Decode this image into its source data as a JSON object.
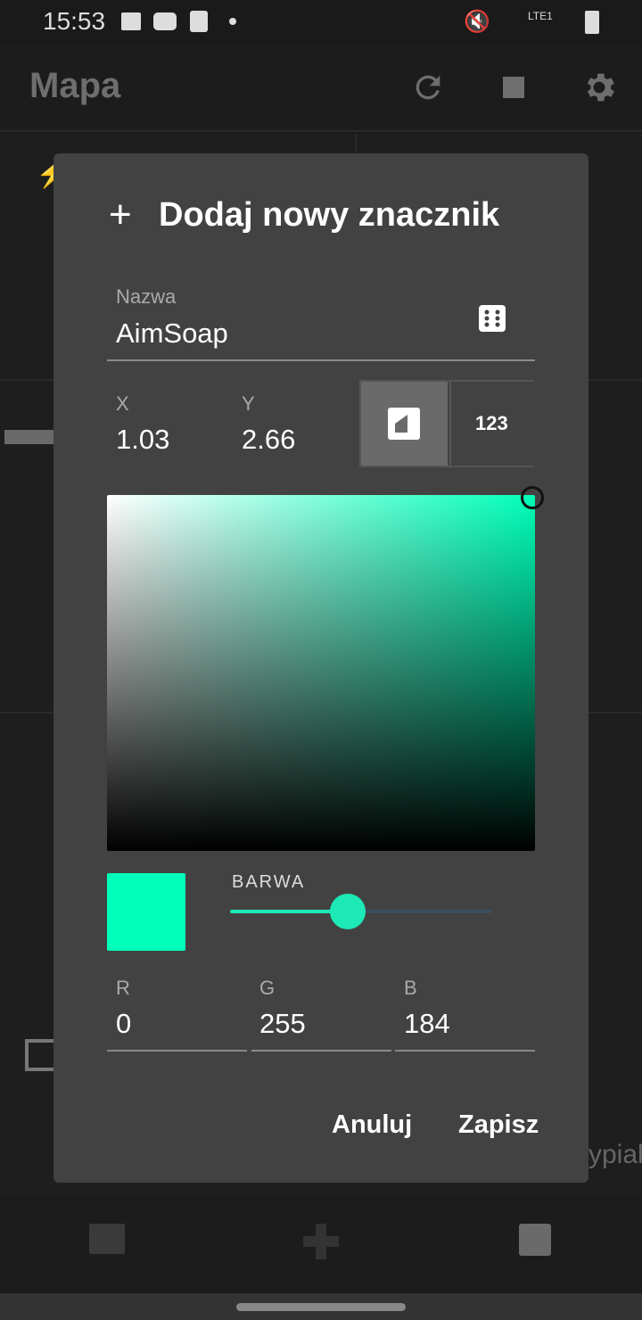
{
  "status_bar": {
    "time": "15:53",
    "network": "LTE1"
  },
  "app_bar": {
    "title": "Mapa"
  },
  "map": {
    "partial_label": "ypialn"
  },
  "dialog": {
    "title": "Dodaj nowy znacznik",
    "name_label": "Nazwa",
    "name_value": "AimSoap",
    "x_label": "X",
    "x_value": "1.03",
    "y_label": "Y",
    "y_value": "2.66",
    "numeric_toggle_label": "123",
    "hue_label": "BARWA",
    "hue_fraction": 0.45,
    "selected_color": "#00FFB8",
    "r_label": "R",
    "r_value": "0",
    "g_label": "G",
    "g_value": "255",
    "b_label": "B",
    "b_value": "184",
    "cancel_label": "Anuluj",
    "save_label": "Zapisz"
  }
}
